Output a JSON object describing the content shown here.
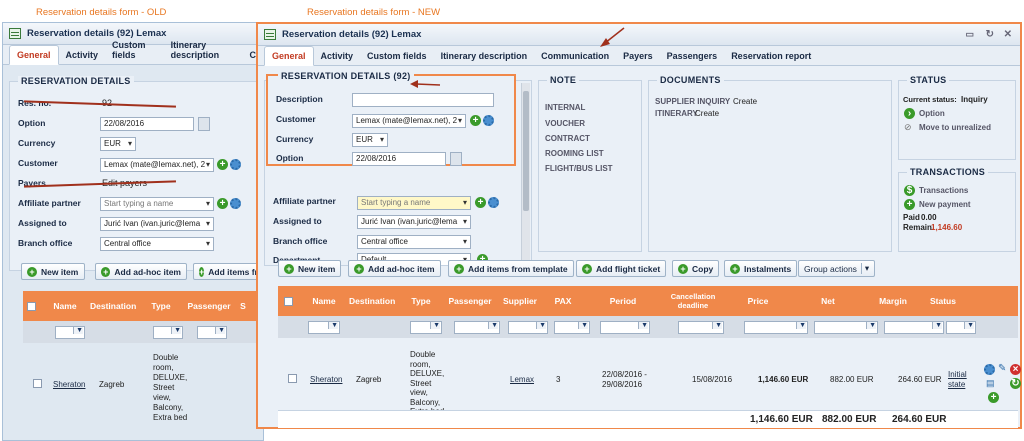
{
  "captions": {
    "old": "Reservation details form - OLD",
    "new": "Reservation details form - NEW"
  },
  "old": {
    "title": "Reservation details (92) Lemax",
    "tabs": [
      "General",
      "Activity",
      "Custom fields",
      "Itinerary description",
      "C"
    ],
    "section": "RESERVATION DETAILS",
    "fields": {
      "resno_label": "Res. no.",
      "resno_value": "92",
      "option_label": "Option",
      "option_value": "22/08/2016",
      "currency_label": "Currency",
      "currency_value": "EUR",
      "customer_label": "Customer",
      "customer_value": "Lemax (mate@lemax.net), 2",
      "payers_label": "Payers",
      "payers_value": "Edit payers",
      "affiliate_label": "Affiliate partner",
      "affiliate_placeholder": "Start typing a name",
      "assigned_label": "Assigned to",
      "assigned_value": "Jurić Ivan (ivan.juric@lema",
      "branch_label": "Branch office",
      "branch_value": "Central office"
    },
    "buttons": [
      "New item",
      "Add ad-hoc item",
      "Add items fr"
    ],
    "headers": [
      "Name",
      "Destination",
      "Type",
      "Passenger",
      "S"
    ],
    "row": {
      "name": "Sheraton",
      "destination": "Zagreb",
      "type": "Double room, DELUXE, Street view, Balcony, Extra bed"
    }
  },
  "new": {
    "title": "Reservation details (92) Lemax",
    "tabs": [
      "General",
      "Activity",
      "Custom fields",
      "Itinerary description",
      "Communication",
      "Payers",
      "Passengers",
      "Reservation report"
    ],
    "section": "RESERVATION DETAILS (92)",
    "fields": {
      "description_label": "Description",
      "customer_label": "Customer",
      "customer_value": "Lemax (mate@lemax.net), 2",
      "currency_label": "Currency",
      "currency_value": "EUR",
      "option_label": "Option",
      "option_value": "22/08/2016",
      "affiliate_label": "Affiliate partner",
      "affiliate_placeholder": "Start typing a name",
      "assigned_label": "Assigned to",
      "assigned_value": "Jurić Ivan (ivan.juric@lema",
      "branch_label": "Branch office",
      "branch_value": "Central office",
      "department_label": "Department",
      "department_value": "Default"
    },
    "note": {
      "title": "NOTE",
      "items": [
        "INTERNAL",
        "VOUCHER",
        "CONTRACT",
        "ROOMING LIST",
        "FLIGHT/BUS LIST"
      ]
    },
    "documents": {
      "title": "DOCUMENTS",
      "items": [
        {
          "name": "SUPPLIER INQUIRY",
          "action": "Create"
        },
        {
          "name": "ITINERARY",
          "action": "Create"
        }
      ]
    },
    "status": {
      "title": "STATUS",
      "current_label": "Current status:",
      "current_value": "Inquiry",
      "option": "Option",
      "unrealized": "Move to unrealized"
    },
    "transactions": {
      "title": "TRANSACTIONS",
      "transactions": "Transactions",
      "new_payment": "New payment",
      "paid_label": "Paid",
      "paid_value": "0.00",
      "remain_label": "Remain.",
      "remain_value": "1,146.60"
    },
    "buttons": {
      "new_item": "New item",
      "adhoc": "Add ad-hoc item",
      "template": "Add items from template",
      "flight": "Add flight ticket",
      "copy": "Copy",
      "instalments": "Instalments",
      "group": "Group actions"
    },
    "headers": [
      "Name",
      "Destination",
      "Type",
      "Passenger",
      "Supplier",
      "PAX",
      "Period",
      "Cancellation deadline",
      "Price",
      "Net",
      "Margin",
      "Status"
    ],
    "row": {
      "name": "Sheraton",
      "destination": "Zagreb",
      "type": "Double room, DELUXE, Street view, Balcony, Extra bed",
      "supplier": "Lemax",
      "pax": "3",
      "period": "22/08/2016 - 29/08/2016",
      "cancellation": "15/08/2016",
      "price": "1,146.60 EUR",
      "net": "882.00 EUR",
      "margin": "264.60 EUR",
      "status": "Initial state"
    },
    "totals": {
      "price": "1,146.60 EUR",
      "net": "882.00 EUR",
      "margin": "264.60 EUR"
    }
  }
}
